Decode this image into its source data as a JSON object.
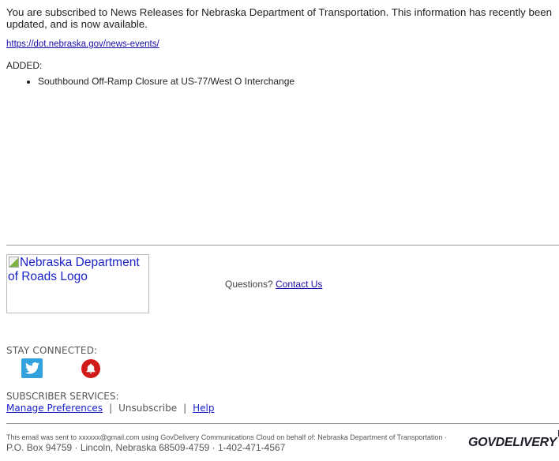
{
  "intro_text": "You are subscribed to News Releases for Nebraska Department of Transportation. This information has recently been updated, and is now available.",
  "news_url": "https://dot.nebraska.gov/news-events/",
  "added_label": "ADDED:",
  "added_items": [
    "Southbound Off-Ramp Closure at US-77/West O Interchange"
  ],
  "logo_alt": "Nebraska Department of Roads Logo",
  "questions_label": "Questions?",
  "contact_link": "Contact Us",
  "stay_connected_label": "STAY CONNECTED:",
  "social_icons": [
    "twitter-icon",
    "bell-icon"
  ],
  "subscriber_services_label": "SUBSCRIBER SERVICES:",
  "subscriber_links": {
    "manage": "Manage Preferences",
    "separator": "|",
    "unsubscribe": "Unsubscribe",
    "help": "Help"
  },
  "footer": {
    "line1": "This email was sent to xxxxxx@gmail.com using GovDelivery Communications Cloud on behalf of: Nebraska Department of Transportation · ",
    "address": "P.O. Box 94759 · Lincoln, Nebraska 68509-4759 · 1-402-471-4567"
  },
  "brand_logo": "GOVDELIVERY",
  "colors": {
    "link": "#1a0dab",
    "twitter": "#33a2dc",
    "bell": "#d11a1a"
  }
}
